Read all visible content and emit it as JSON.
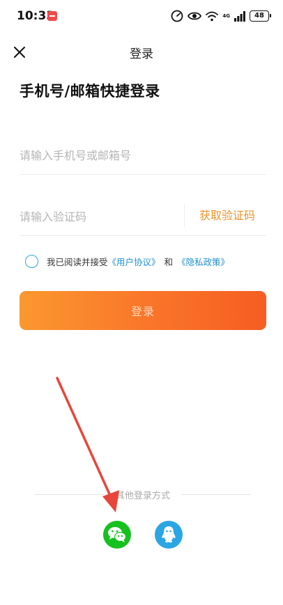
{
  "status_bar": {
    "time": "10:33",
    "battery": "48",
    "network": "4G"
  },
  "header": {
    "title": "登录",
    "close_icon": "close-icon"
  },
  "page": {
    "heading": "手机号/邮箱快捷登录"
  },
  "form": {
    "account_placeholder": "请输入手机号或邮箱号",
    "code_placeholder": "请输入验证码",
    "get_code_label": "获取验证码",
    "login_label": "登录"
  },
  "agreement": {
    "prefix": "我已阅读并接受",
    "user_agreement": "《用户协议》",
    "conjunction": "和",
    "privacy_policy": "《隐私政策》"
  },
  "other_login": {
    "label": "其他登录方式",
    "wechat_icon": "wechat-icon",
    "qq_icon": "qq-icon"
  },
  "colors": {
    "accent": "#f0932b",
    "button_start": "#fb982f",
    "button_end": "#f65d22",
    "link": "#1f8fd1",
    "wechat": "#15c11e",
    "qq": "#2aa6e5",
    "annotation": "#e8463a"
  }
}
